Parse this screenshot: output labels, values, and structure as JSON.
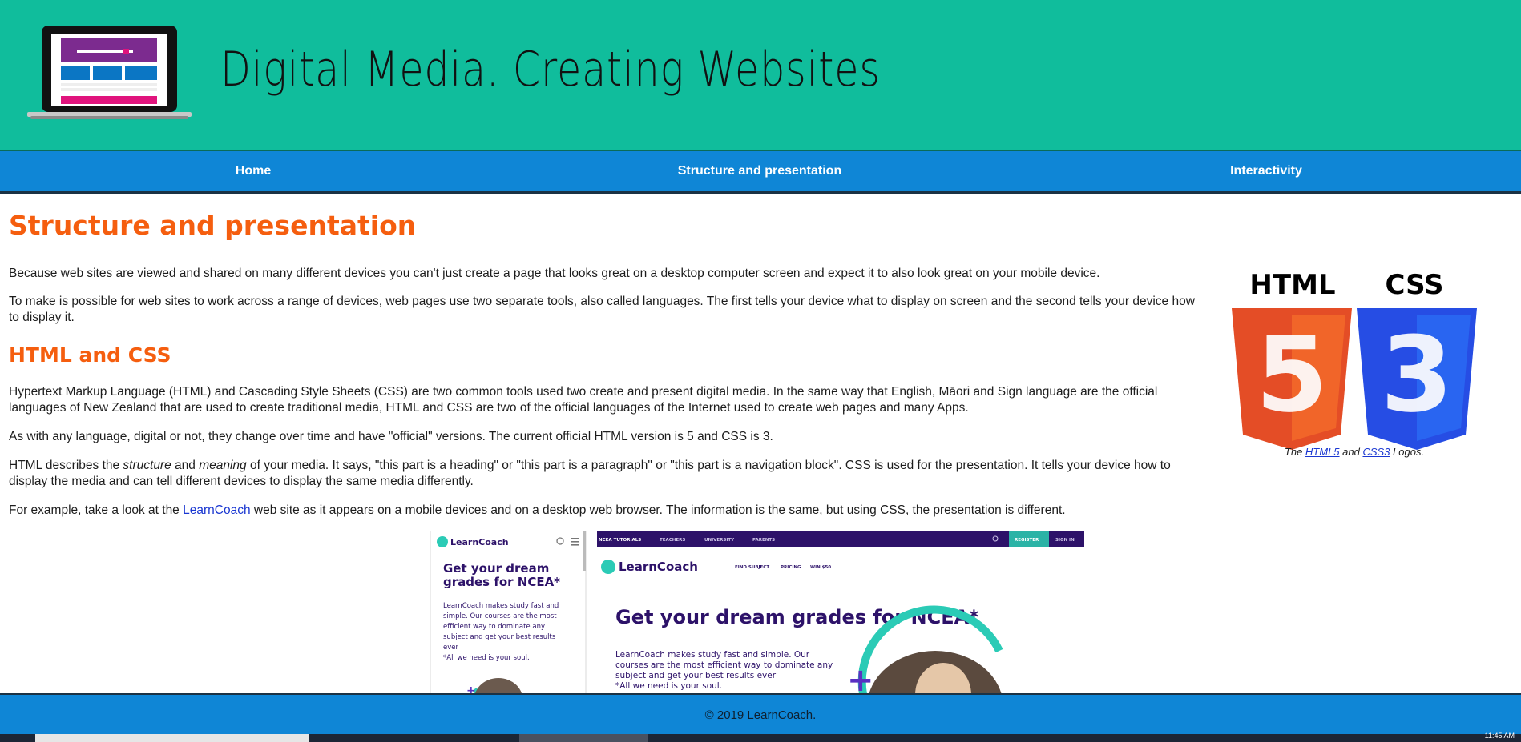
{
  "header": {
    "title": "Digital Media. Creating Websites"
  },
  "nav": {
    "items": [
      {
        "label": "Home"
      },
      {
        "label": "Structure and presentation"
      },
      {
        "label": "Interactivity"
      }
    ]
  },
  "main": {
    "heading": "Structure and presentation",
    "p1": "Because web sites are viewed and shared on many different devices you can't just create a page that looks great on a desktop computer screen and expect it to also look great on your mobile device.",
    "p2": "To make is possible for web sites to work across a range of devices, web pages use two separate tools, also called languages. The first tells your device what to display on screen and the second tells your device how to display it.",
    "subheading": "HTML and CSS",
    "p3": "Hypertext Markup Language (HTML) and Cascading Style Sheets (CSS) are two common tools used two create and present digital media. In the same way that English, Māori and Sign language are the official languages of New Zealand that are used to create traditional media, HTML and CSS are two of the official languages of the Internet used to create web pages and many Apps.",
    "p4": "As with any language, digital or not, they change over time and have \"official\" versions. The current official HTML version is 5 and CSS is 3.",
    "p5": {
      "a": "HTML describes the ",
      "structure": "structure",
      "b": " and ",
      "meaning": "meaning",
      "c": " of your media. It says, \"this part is a heading\" or \"this part is a paragraph\" or \"this part is a navigation block\". CSS is used for the presentation. It tells your device how to display the media and can tell different devices to display the same media differently."
    },
    "p6": {
      "a": "For example, take a look at the ",
      "link": "LearnCoach",
      "b": " web site as it appears on a mobile devices and on a desktop web browser. The information is the same, but using CSS, the presentation is different."
    }
  },
  "logos": {
    "html_label": "HTML",
    "css_label": "CSS",
    "html_num": "5",
    "css_num": "3",
    "caption": {
      "a": "The ",
      "html5": "HTML5",
      "b": " and ",
      "css3": "CSS3",
      "c": " Logos."
    }
  },
  "screenshot": {
    "mobile": {
      "brand": "LearnCoach",
      "headline_1": "Get your dream",
      "headline_2": "grades for NCEA*",
      "body_1": "LearnCoach makes study fast and",
      "body_2": "simple. Our courses are the most",
      "body_3": "efficient way to dominate any",
      "body_4": "subject and get your best results",
      "body_5": "ever",
      "body_6": "*All we need is your soul."
    },
    "desktop": {
      "topnav": [
        "NCEA TUTORIALS",
        "TEACHERS",
        "UNIVERSITY",
        "PARENTS"
      ],
      "register": "REGISTER",
      "signin": "SIGN IN",
      "brand": "LearnCoach",
      "links": [
        "FIND SUBJECT",
        "PRICING",
        "WIN $50"
      ],
      "headline": "Get your dream grades for NCEA*",
      "body_1": "LearnCoach makes study fast and simple. Our",
      "body_2": "courses are the most efficient way to dominate any",
      "body_3": "subject and get your best results ever",
      "body_4": "*All we need is your soul."
    }
  },
  "footer": {
    "text": "© 2019 LearnCoach."
  },
  "taskbar": {
    "clock": "11:45 AM"
  },
  "colors": {
    "header_bg": "#10bd9c",
    "nav_bg": "#0f86d6",
    "heading": "#f55e0f",
    "learncoach_purple": "#2d1269",
    "learncoach_teal": "#2bcbb6"
  }
}
